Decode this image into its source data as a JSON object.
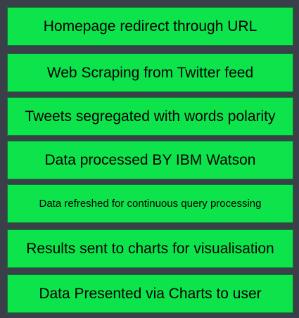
{
  "steps": [
    {
      "label": "Homepage redirect through URL"
    },
    {
      "label": "Web Scraping from Twitter feed"
    },
    {
      "label": "Tweets segregated with words polarity"
    },
    {
      "label": "Data processed BY IBM Watson"
    },
    {
      "label": "Data refreshed for continuous query processing"
    },
    {
      "label": "Results sent to charts for visualisation"
    },
    {
      "label": "Data Presented via Charts to user"
    }
  ],
  "colors": {
    "background": "#3a3f4a",
    "box_fill": "#0de44b",
    "box_border": "#0a7a2c",
    "text": "#000000"
  }
}
